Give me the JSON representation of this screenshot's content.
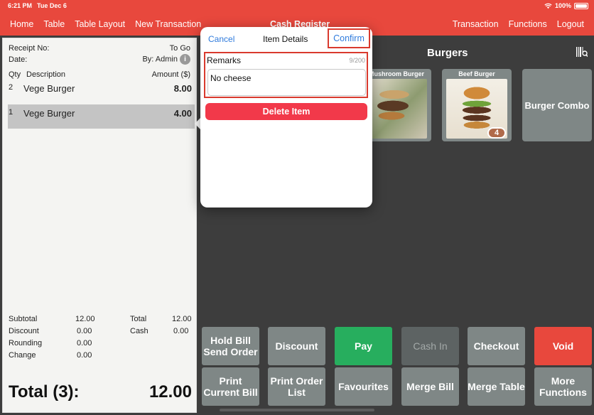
{
  "status_bar": {
    "time": "6:21 PM",
    "date": "Tue Dec 6",
    "battery": "100%"
  },
  "nav": {
    "left": [
      "Home",
      "Table",
      "Table Layout",
      "New Transaction"
    ],
    "title": "Cash Register",
    "right": [
      "Transaction",
      "Functions",
      "Logout"
    ]
  },
  "receipt": {
    "receipt_no_label": "Receipt No:",
    "order_type": "To Go",
    "date_label": "Date:",
    "by": "By: Admin",
    "col_qty": "Qty",
    "col_desc": "Description",
    "col_amount": "Amount ($)",
    "items": [
      {
        "qty": "2",
        "desc": "Vege Burger",
        "amount": "8.00"
      },
      {
        "qty": "1",
        "desc": "Vege Burger",
        "amount": "4.00"
      }
    ],
    "subtotal_label": "Subtotal",
    "subtotal": "12.00",
    "discount_label": "Discount",
    "discount": "0.00",
    "rounding_label": "Rounding",
    "rounding": "0.00",
    "change_label": "Change",
    "change": "0.00",
    "total_label": "Total",
    "total": "12.00",
    "cash_label": "Cash",
    "cash": "0.00",
    "grand_total_label": "Total (3):",
    "grand_total": "12.00"
  },
  "category": {
    "title": "Burgers"
  },
  "products": [
    {
      "name": "Mushroom Burger"
    },
    {
      "name": "Beef Burger",
      "badge": "4"
    },
    {
      "name": "Burger Combo"
    }
  ],
  "actions": {
    "hold_bill": "Hold Bill\nSend Order",
    "discount": "Discount",
    "pay": "Pay",
    "cash_in": "Cash In",
    "checkout": "Checkout",
    "void": "Void",
    "print_current_bill": "Print\nCurrent Bill",
    "print_order_list": "Print Order\nList",
    "favourites": "Favourites",
    "merge_bill": "Merge Bill",
    "merge_table": "Merge Table",
    "more_functions": "More\nFunctions"
  },
  "popover": {
    "cancel": "Cancel",
    "title": "Item Details",
    "confirm": "Confirm",
    "remarks_label": "Remarks",
    "remarks_count": "9/200",
    "remarks_value": "No cheese",
    "delete": "Delete Item"
  },
  "colors": {
    "brand": "#e8483d",
    "accent_blue": "#2f7bdc",
    "pay_green": "#27ae5e",
    "tile_gray": "#7f8786",
    "background": "#3d3d3d"
  }
}
